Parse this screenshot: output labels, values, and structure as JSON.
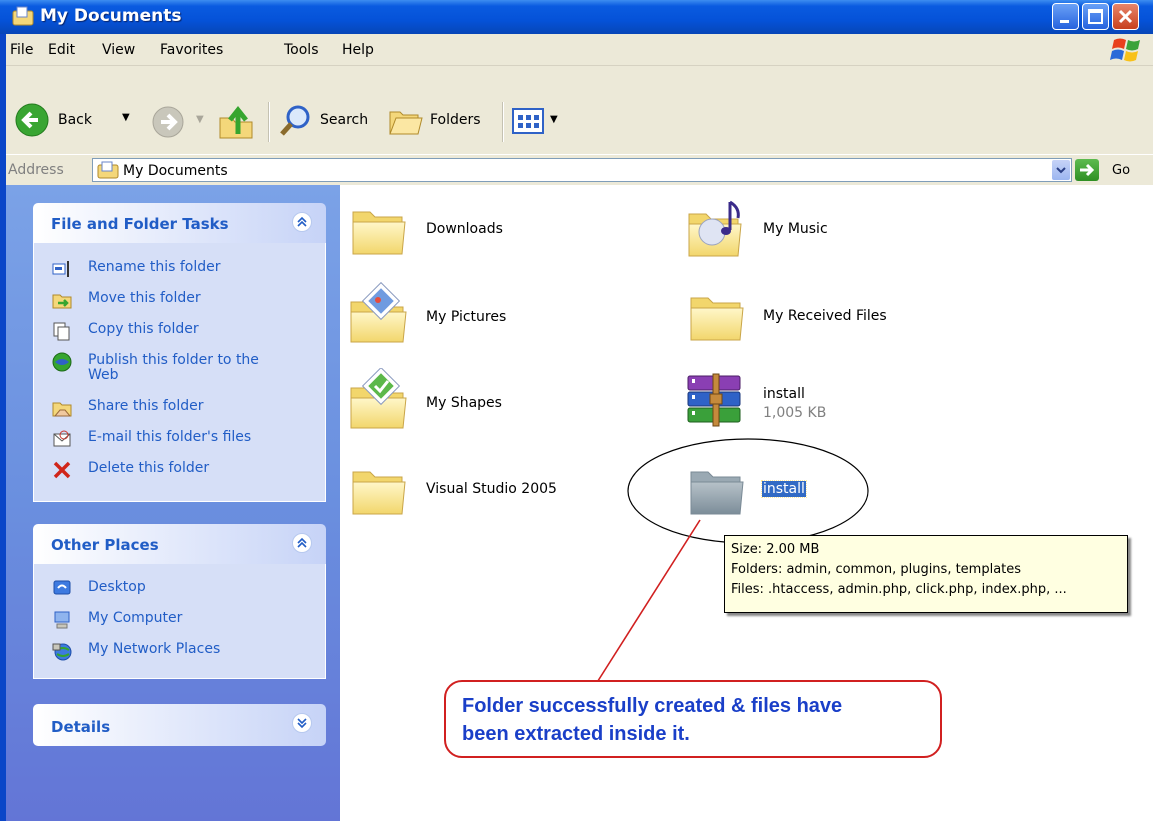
{
  "window": {
    "title": "My Documents"
  },
  "menu": {
    "items": [
      "File",
      "Edit",
      "View",
      "Favorites",
      "Tools",
      "Help"
    ]
  },
  "toolbar": {
    "back_label": "Back",
    "search_label": "Search",
    "folders_label": "Folders"
  },
  "address": {
    "label": "Address",
    "value": "My Documents",
    "go_label": "Go"
  },
  "tasks_panel": {
    "title": "File and Folder Tasks",
    "items": [
      {
        "label": "Rename this folder",
        "icon": "rename-icon"
      },
      {
        "label": "Move this folder",
        "icon": "move-icon"
      },
      {
        "label": "Copy this folder",
        "icon": "copy-icon"
      },
      {
        "label_line1": "Publish this folder to the",
        "label_line2": "Web",
        "icon": "publish-web-icon"
      },
      {
        "label": "Share this folder",
        "icon": "share-icon"
      },
      {
        "label": "E-mail this folder's files",
        "icon": "email-icon"
      },
      {
        "label": "Delete this folder",
        "icon": "delete-icon"
      }
    ]
  },
  "places_panel": {
    "title": "Other Places",
    "items": [
      {
        "label": "Desktop",
        "icon": "desktop-icon"
      },
      {
        "label": "My Computer",
        "icon": "my-computer-icon"
      },
      {
        "label": "My Network Places",
        "icon": "network-places-icon"
      }
    ]
  },
  "details_panel": {
    "title": "Details"
  },
  "files": {
    "items": [
      {
        "name": "Downloads",
        "icon": "folder-icon"
      },
      {
        "name": "My Music",
        "icon": "music-folder-icon"
      },
      {
        "name": "My Pictures",
        "icon": "pictures-folder-icon"
      },
      {
        "name": "My Received Files",
        "icon": "folder-icon"
      },
      {
        "name": "My Shapes",
        "icon": "shapes-folder-icon"
      },
      {
        "name": "install",
        "size": "1,005 KB",
        "icon": "rar-archive-icon"
      },
      {
        "name": "Visual Studio 2005",
        "icon": "folder-icon"
      },
      {
        "name": "install",
        "icon": "folder-icon",
        "selected": true
      }
    ]
  },
  "tooltip": {
    "size": "Size: 2.00 MB",
    "folders": "Folders: admin, common, plugins, templates",
    "files": "Files: .htaccess, admin.php, click.php, index.php, ..."
  },
  "annotation": {
    "line1": "Folder successfully created & files have",
    "line2": "been extracted inside it."
  },
  "colors": {
    "title_bar": "#0552d8",
    "task_pane": "#6a8fdf",
    "panel_title": "#215dc6",
    "selection": "#316ac5",
    "annotation_text": "#1a3fc8",
    "annotation_border": "#d12020"
  }
}
